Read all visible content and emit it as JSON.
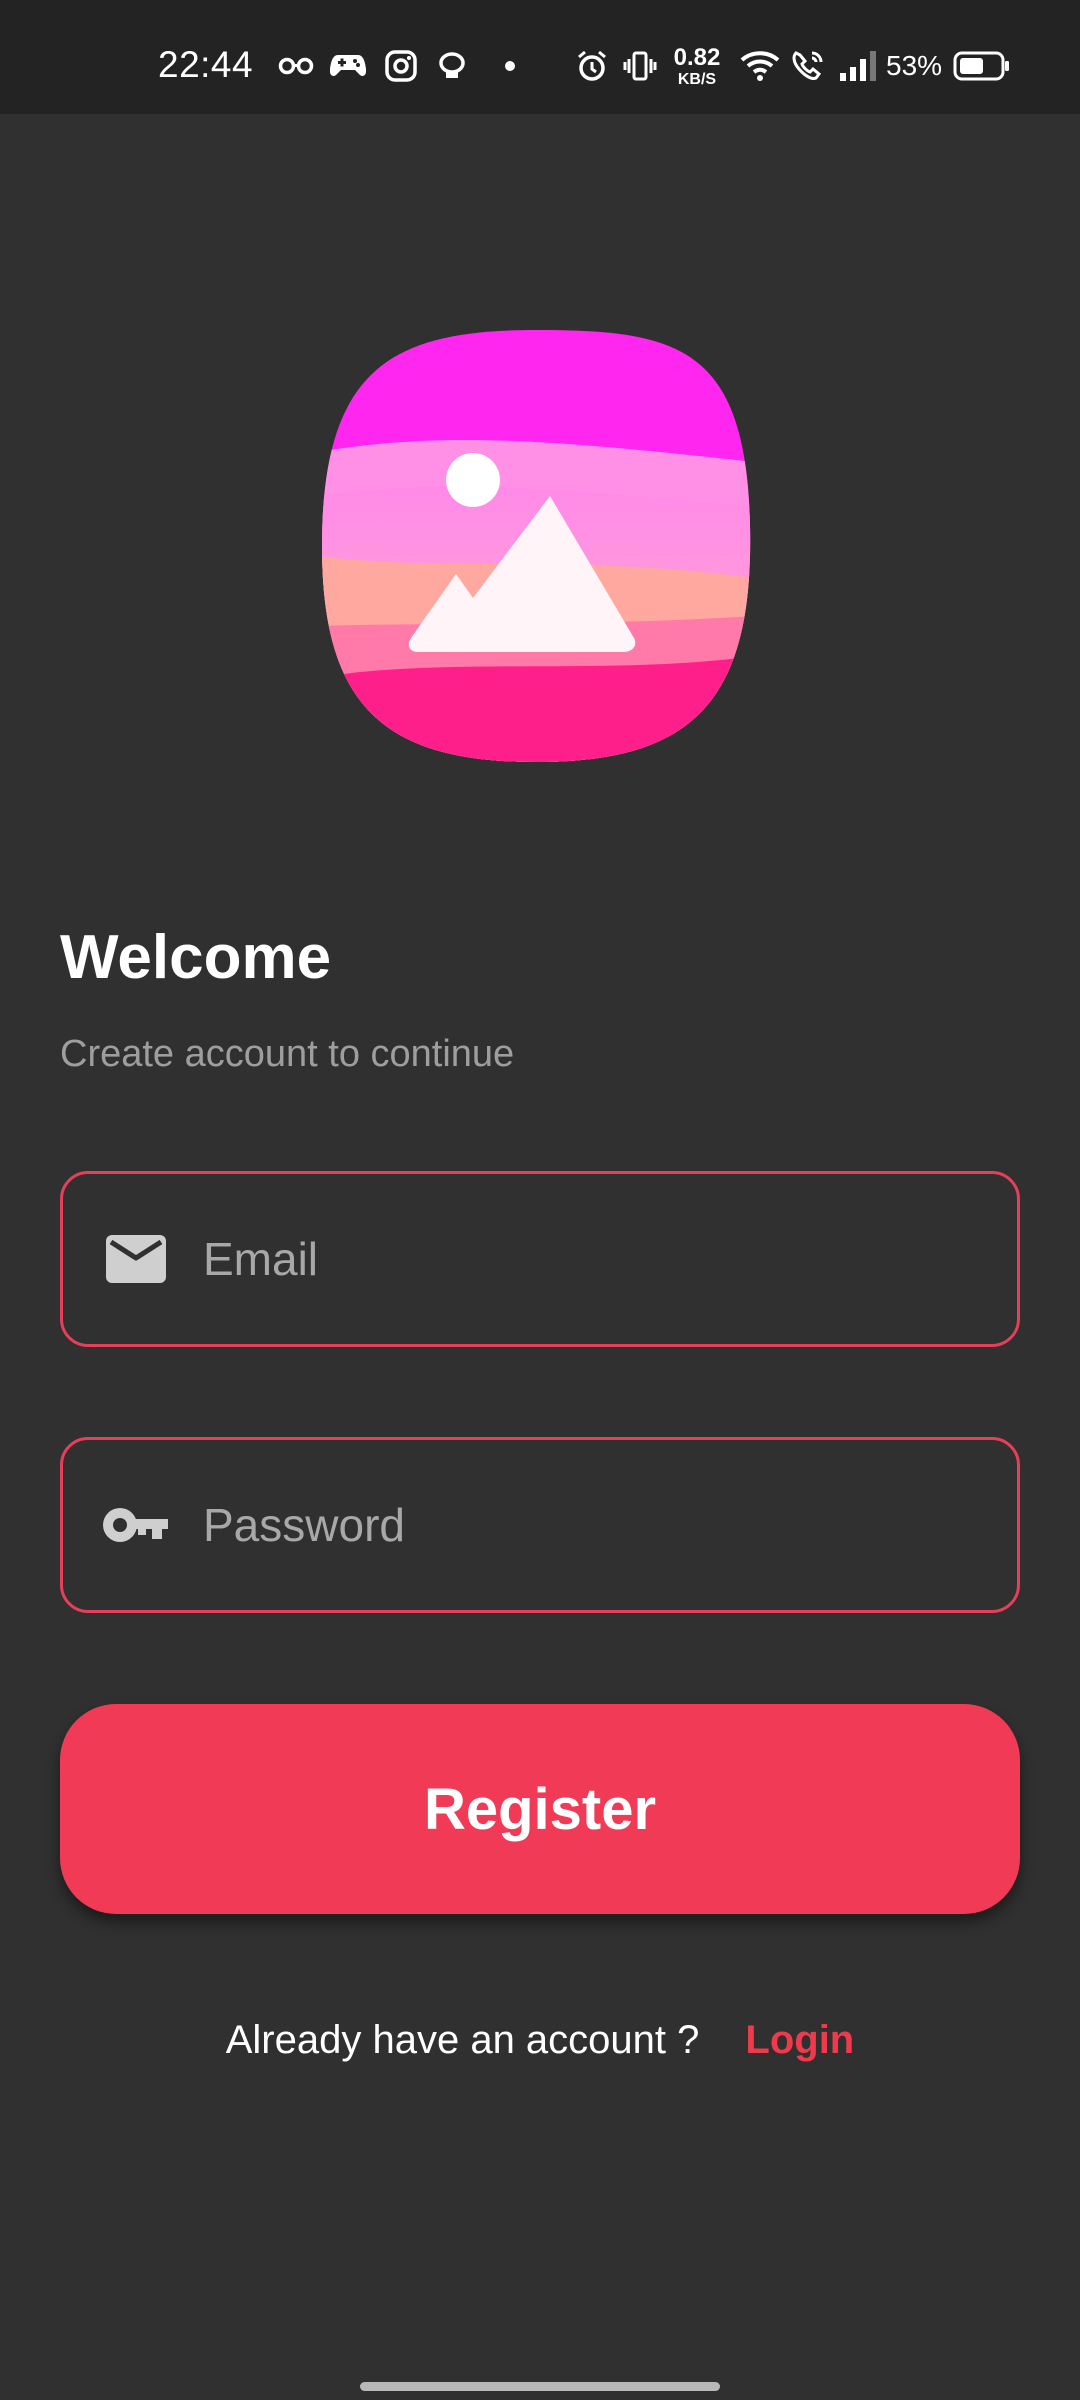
{
  "status_bar": {
    "time": "22:44",
    "net_speed_value": "0.82",
    "net_speed_unit": "KB/S",
    "battery_percent": "53%",
    "icons": [
      "glasses-icon",
      "gamepad-icon",
      "instagram-icon",
      "ring-icon",
      "dot-icon",
      "alarm-icon",
      "vibrate-icon",
      "wifi-icon",
      "wifi-call-icon",
      "signal-icon",
      "battery-icon"
    ]
  },
  "app": {
    "logo_icon": "gallery-logo-icon",
    "title": "Welcome",
    "subtitle": "Create account to continue"
  },
  "form": {
    "email": {
      "placeholder": "Email",
      "value": "",
      "icon": "mail-icon"
    },
    "password": {
      "placeholder": "Password",
      "value": "",
      "icon": "key-icon"
    },
    "register_label": "Register"
  },
  "footer": {
    "question": "Already have an account ?",
    "login_label": "Login"
  },
  "colors": {
    "background": "#303030",
    "status_bar": "#232323",
    "accent": "#f03a56",
    "field_border": "#e63f59",
    "link": "#ee3a4c",
    "muted_text": "#9e9e9e"
  }
}
